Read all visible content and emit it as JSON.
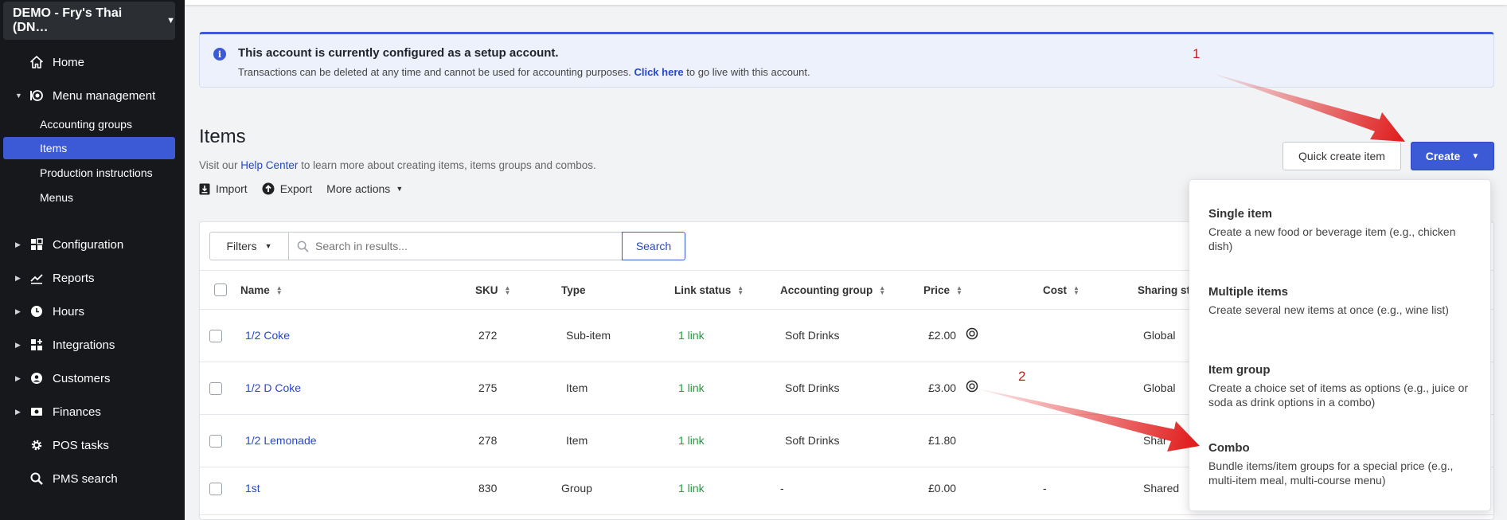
{
  "sidebar": {
    "venue": "DEMO - Fry's Thai (DN…",
    "items": [
      {
        "label": "Home"
      },
      {
        "label": "Menu management"
      },
      {
        "label": "Configuration"
      },
      {
        "label": "Reports"
      },
      {
        "label": "Hours"
      },
      {
        "label": "Integrations"
      },
      {
        "label": "Customers"
      },
      {
        "label": "Finances"
      },
      {
        "label": "POS tasks"
      },
      {
        "label": "PMS search"
      }
    ],
    "submenu": [
      {
        "label": "Accounting groups",
        "active": false
      },
      {
        "label": "Items",
        "active": true
      },
      {
        "label": "Production instructions",
        "active": false
      },
      {
        "label": "Menus",
        "active": false
      }
    ]
  },
  "banner": {
    "title": "This account is currently configured as a setup account.",
    "text_before": "Transactions can be deleted at any time and cannot be used for accounting purposes.",
    "link": "Click here",
    "text_after": "to go live with this account."
  },
  "page": {
    "title": "Items",
    "help_before": "Visit our",
    "help_link": "Help Center",
    "help_after": "to learn more about creating items, items groups and combos.",
    "import_label": "Import",
    "export_label": "Export",
    "more_actions_label": "More actions"
  },
  "buttons": {
    "quick_create": "Quick create item",
    "create": "Create"
  },
  "toolbar": {
    "filters_label": "Filters",
    "search_placeholder": "Search in results...",
    "search_button": "Search"
  },
  "table": {
    "columns": {
      "name": "Name",
      "sku": "SKU",
      "type": "Type",
      "link_status": "Link status",
      "accounting_group": "Accounting group",
      "price": "Price",
      "cost": "Cost",
      "sharing_status": "Sharing sta"
    },
    "rows": [
      {
        "name": "1/2 Coke",
        "sku": "272",
        "type": "Sub-item",
        "link_status": "1 link",
        "accounting_group": "Soft Drinks",
        "price": "£2.00",
        "cost": "",
        "sharing": "Global"
      },
      {
        "name": "1/2 D Coke",
        "sku": "275",
        "type": "Item",
        "link_status": "1 link",
        "accounting_group": "Soft Drinks",
        "price": "£3.00",
        "cost": "",
        "sharing": "Global"
      },
      {
        "name": "1/2 Lemonade",
        "sku": "278",
        "type": "Item",
        "link_status": "1 link",
        "accounting_group": "Soft Drinks",
        "price": "£1.80",
        "cost": "",
        "sharing": "Shar"
      },
      {
        "name": "1st",
        "sku": "830",
        "type": "Group",
        "link_status": "1 link",
        "accounting_group": "-",
        "price": "£0.00",
        "cost": "-",
        "sharing": "Shared"
      }
    ]
  },
  "create_menu": {
    "options": [
      {
        "title": "Single item",
        "description": "Create a new food or beverage item (e.g., chicken dish)"
      },
      {
        "title": "Multiple items",
        "description": "Create several new items at once (e.g., wine list)"
      },
      {
        "title": "Item group",
        "description": "Create a choice set of items as options (e.g., juice or soda as drink options in a combo)"
      },
      {
        "title": "Combo",
        "description": "Bundle items/item groups for a special price (e.g., multi-item meal, multi-course menu)"
      }
    ]
  },
  "annotations": {
    "step1": "1",
    "step2": "2"
  },
  "colors": {
    "sidebar_bg": "#16181c",
    "accent": "#3c5ad6",
    "link": "#2747c9",
    "link_status_green": "#1e9e3a",
    "annotation_red": "#e01b1b"
  }
}
